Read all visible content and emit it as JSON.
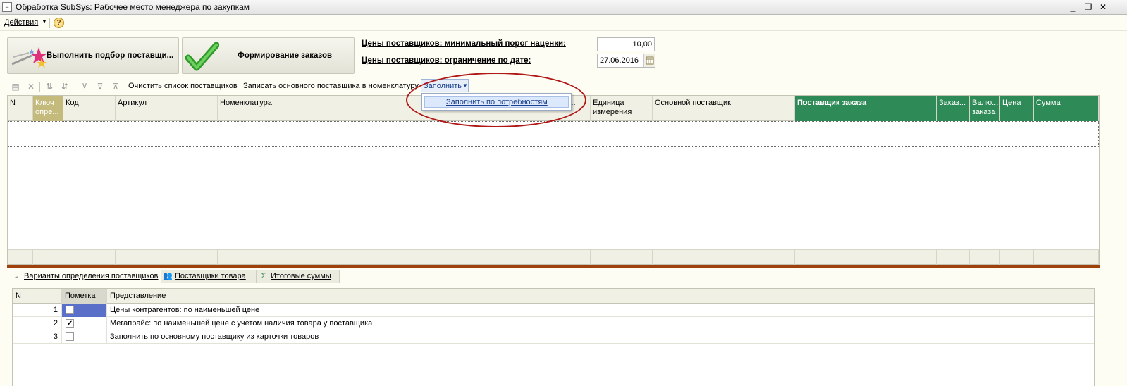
{
  "window": {
    "title": "Обработка  SubSys: Рабочее место менеджера по закупкам",
    "controls": [
      "_",
      "❐",
      "✕"
    ]
  },
  "menubar": {
    "actions_label": "Действия",
    "help_label": "?"
  },
  "buttons": {
    "select_suppliers": "Выполнить подбор поставщи...",
    "form_orders": "Формирование заказов"
  },
  "params": {
    "min_markup_label": "Цены поставщиков: минимальный порог наценки:",
    "min_markup_value": "10,00",
    "date_limit_label": "Цены поставщиков: ограничение по дате:",
    "date_limit_value": "27.06.2016"
  },
  "toolbar": {
    "clear_suppliers": "Очистить список поставщиков",
    "write_main_supplier": "Записать основного поставщика в номенклатуру",
    "fill_label": "Заполнить"
  },
  "popup": {
    "fill_by_needs": "Заполнить по потребностям"
  },
  "grid": {
    "columns": [
      "N",
      "Ключ опре...",
      "Код",
      "Артикул",
      "Номенклатура",
      "Количести...",
      "Единица измерения",
      "Основной поставщик",
      "Поставщик заказа",
      "Заказ...",
      "Валю... заказа",
      "Цена",
      "Сумма"
    ]
  },
  "tabs": [
    {
      "label": "Варианты определения поставщиков",
      "icon": "search-icon"
    },
    {
      "label": "Поставщики товара",
      "icon": "people-icon"
    },
    {
      "label": "Итоговые суммы",
      "icon": "sum-icon"
    }
  ],
  "variants": {
    "headers": [
      "N",
      "Пометка",
      "Представление"
    ],
    "rows": [
      {
        "n": "1",
        "checked": false,
        "text": "Цены контрагентов: по наименьшей цене"
      },
      {
        "n": "2",
        "checked": true,
        "text": "Мегапрайс: по наименьшей цене с учетом наличия товара у поставщика"
      },
      {
        "n": "3",
        "checked": false,
        "text": "Заполнить по основному поставщику из карточки товаров"
      }
    ]
  },
  "colors": {
    "accent_green": "#2e8b57",
    "key_column": "#c4ba7c",
    "splitter": "#a0400a",
    "highlight_ellipse": "#b01818"
  }
}
